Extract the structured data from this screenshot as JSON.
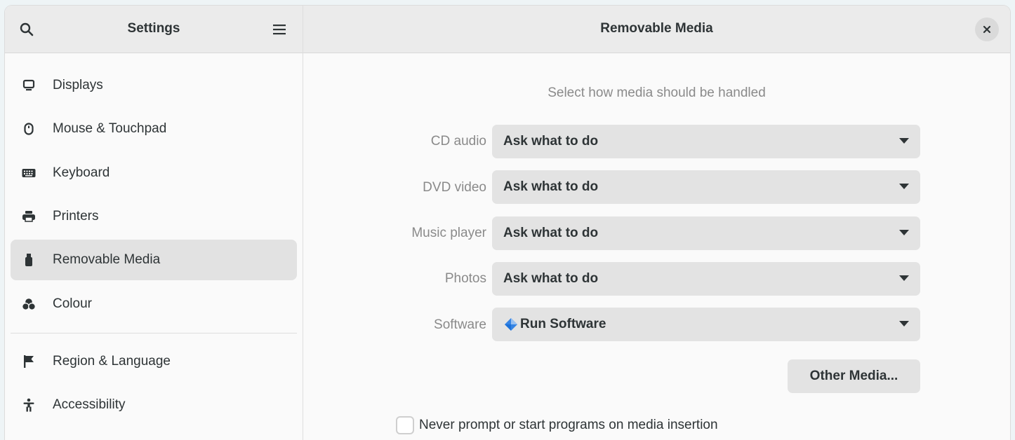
{
  "sidebar": {
    "title": "Settings",
    "items": [
      {
        "label": "Displays",
        "icon": "display-icon"
      },
      {
        "label": "Mouse & Touchpad",
        "icon": "mouse-icon"
      },
      {
        "label": "Keyboard",
        "icon": "keyboard-icon"
      },
      {
        "label": "Printers",
        "icon": "printer-icon"
      },
      {
        "label": "Removable Media",
        "icon": "usb-drive-icon",
        "active": true
      },
      {
        "label": "Colour",
        "icon": "colour-icon"
      },
      {
        "label": "Region & Language",
        "icon": "flag-icon"
      },
      {
        "label": "Accessibility",
        "icon": "accessibility-icon"
      }
    ]
  },
  "main": {
    "title": "Removable Media",
    "subtitle": "Select how media should be handled",
    "rows": [
      {
        "label": "CD audio",
        "value": "Ask what to do"
      },
      {
        "label": "DVD video",
        "value": "Ask what to do"
      },
      {
        "label": "Music player",
        "value": "Ask what to do"
      },
      {
        "label": "Photos",
        "value": "Ask what to do"
      },
      {
        "label": "Software",
        "value": "Run Software",
        "icon": "software-icon"
      }
    ],
    "other_media_label": "Other Media...",
    "never_prompt_label": "Never prompt or start programs on media insertion",
    "never_prompt_checked": false
  },
  "colors": {
    "header_bg": "#ebebeb",
    "active_item_bg": "#e2e2e2",
    "dropdown_bg": "#e3e3e3",
    "software_icon": "#3584e4"
  }
}
